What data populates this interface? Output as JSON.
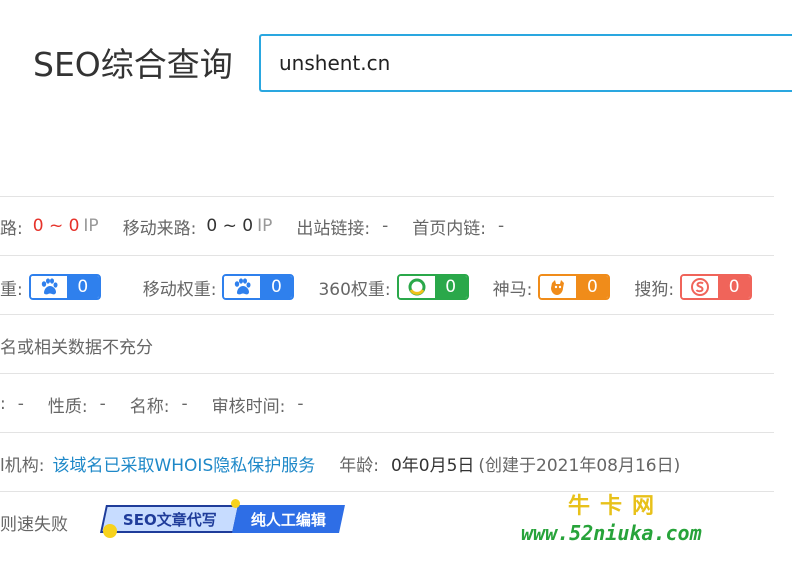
{
  "header": {
    "title": "SEO综合查询",
    "search_value": "unshent.cn"
  },
  "traffic_row": {
    "pc_label": "路:",
    "pc_value": "0 ~ 0",
    "pc_unit": "IP",
    "mobile_label": "移动来路:",
    "mobile_value": "0 ~ 0",
    "mobile_unit": "IP",
    "outbound_label": "出站链接:",
    "outbound_value": "-",
    "internal_label": "首页内链:",
    "internal_value": "-"
  },
  "weight_row": {
    "pc_label": "重:",
    "pc_value": "0",
    "mobile_label": "移动权重:",
    "mobile_value": "0",
    "w360_label": "360权重:",
    "w360_value": "0",
    "shenma_label": "神马:",
    "shenma_value": "0",
    "sogou_label": "搜狗:",
    "sogou_value": "0",
    "colors": {
      "baidu": "#2f80ed",
      "mobile": "#2f80ed",
      "w360": "#2aa84a",
      "shenma": "#f08c1a",
      "sogou": "#f0645a"
    }
  },
  "rank_row": {
    "text": "名或相关数据不充分"
  },
  "icp_row": {
    "lead": ":",
    "lead_value": "-",
    "nature_label": "性质:",
    "nature_value": "-",
    "name_label": "名称:",
    "name_value": "-",
    "audit_label": "审核时间:",
    "audit_value": "-"
  },
  "whois_row": {
    "registrar_label": "l机构:",
    "registrar_value": "该域名已采取WHOIS隐私保护服务",
    "age_label": "年龄:",
    "age_value": "0年0月5日",
    "created_note": "(创建于2021年08月16日)"
  },
  "speed_row": {
    "text": "则速失败",
    "promo_left": "SEO文章代写",
    "promo_right": "纯人工编辑"
  },
  "watermark": {
    "top": "牛卡网",
    "bottom": "www.52niuka.com"
  }
}
